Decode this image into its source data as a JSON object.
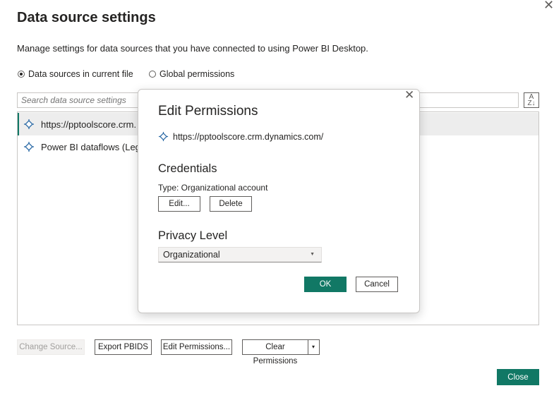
{
  "dialog": {
    "title": "Data source settings",
    "close_glyph": "✕",
    "description": "Manage settings for data sources that you have connected to using Power BI Desktop."
  },
  "scope": {
    "options": [
      "Data sources in current file",
      "Global permissions"
    ],
    "selected": "Data sources in current file"
  },
  "search": {
    "placeholder": "Search data source settings",
    "sort_icon": "sort-az-icon",
    "sort_glyph_top": "A",
    "sort_glyph_bottom": "Z↓"
  },
  "sources": [
    {
      "label": "https://pptoolscore.crm.",
      "icon": "data-source-icon",
      "selected": true
    },
    {
      "label": "Power BI dataflows (Lega",
      "icon": "data-source-icon",
      "selected": false
    }
  ],
  "footer": {
    "change_source": "Change Source...",
    "export_pbids": "Export PBIDS",
    "edit_permissions": "Edit Permissions...",
    "clear_permissions": "Clear Permissions",
    "clear_dropdown_glyph": "▾",
    "close": "Close"
  },
  "edit_permissions": {
    "title": "Edit Permissions",
    "close_glyph": "✕",
    "url": "https://pptoolscore.crm.dynamics.com/",
    "credentials_heading": "Credentials",
    "credentials_type": "Type: Organizational account",
    "edit_label": "Edit...",
    "delete_label": "Delete",
    "privacy_heading": "Privacy Level",
    "privacy_level": "Organizational",
    "privacy_caret": "▼",
    "ok_label": "OK",
    "cancel_label": "Cancel"
  },
  "colors": {
    "accent": "#117865",
    "selected_row": "#ededed",
    "icon_blue": "#2b6aa6"
  }
}
